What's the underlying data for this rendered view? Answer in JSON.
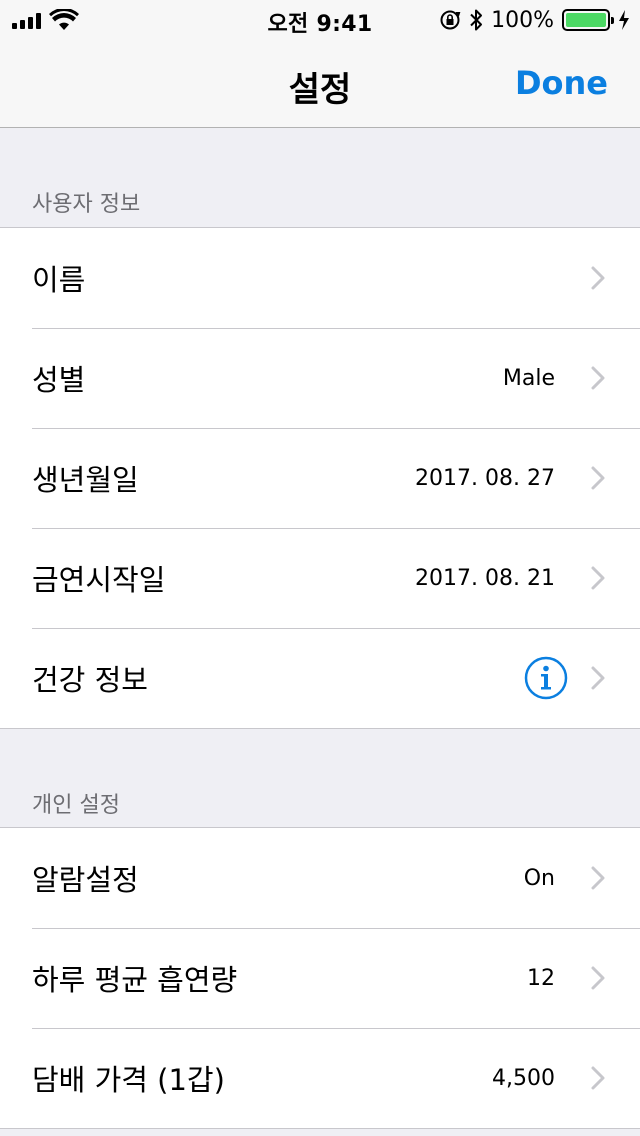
{
  "status_bar": {
    "time": "오전 9:41",
    "battery_percent": "100%",
    "battery_color": "#4cd964",
    "icons": [
      "signal-icon",
      "wifi-icon",
      "orientation-lock-icon",
      "bluetooth-icon",
      "battery-icon",
      "charging-icon"
    ]
  },
  "nav": {
    "title": "설정",
    "done_label": "Done",
    "accent_color": "#0b7fe0"
  },
  "sections": [
    {
      "header": "사용자 정보",
      "rows": [
        {
          "label": "이름",
          "value": ""
        },
        {
          "label": "성별",
          "value": "Male"
        },
        {
          "label": "생년월일",
          "value": "2017. 08. 27"
        },
        {
          "label": "금연시작일",
          "value": "2017. 08. 21"
        },
        {
          "label": "건강 정보",
          "value": "",
          "icon": "info-icon"
        }
      ]
    },
    {
      "header": "개인 설정",
      "rows": [
        {
          "label": "알람설정",
          "value": "On"
        },
        {
          "label": "하루 평균 흡연량",
          "value": "12"
        },
        {
          "label": "담배 가격 (1갑)",
          "value": "4,500"
        }
      ]
    }
  ]
}
